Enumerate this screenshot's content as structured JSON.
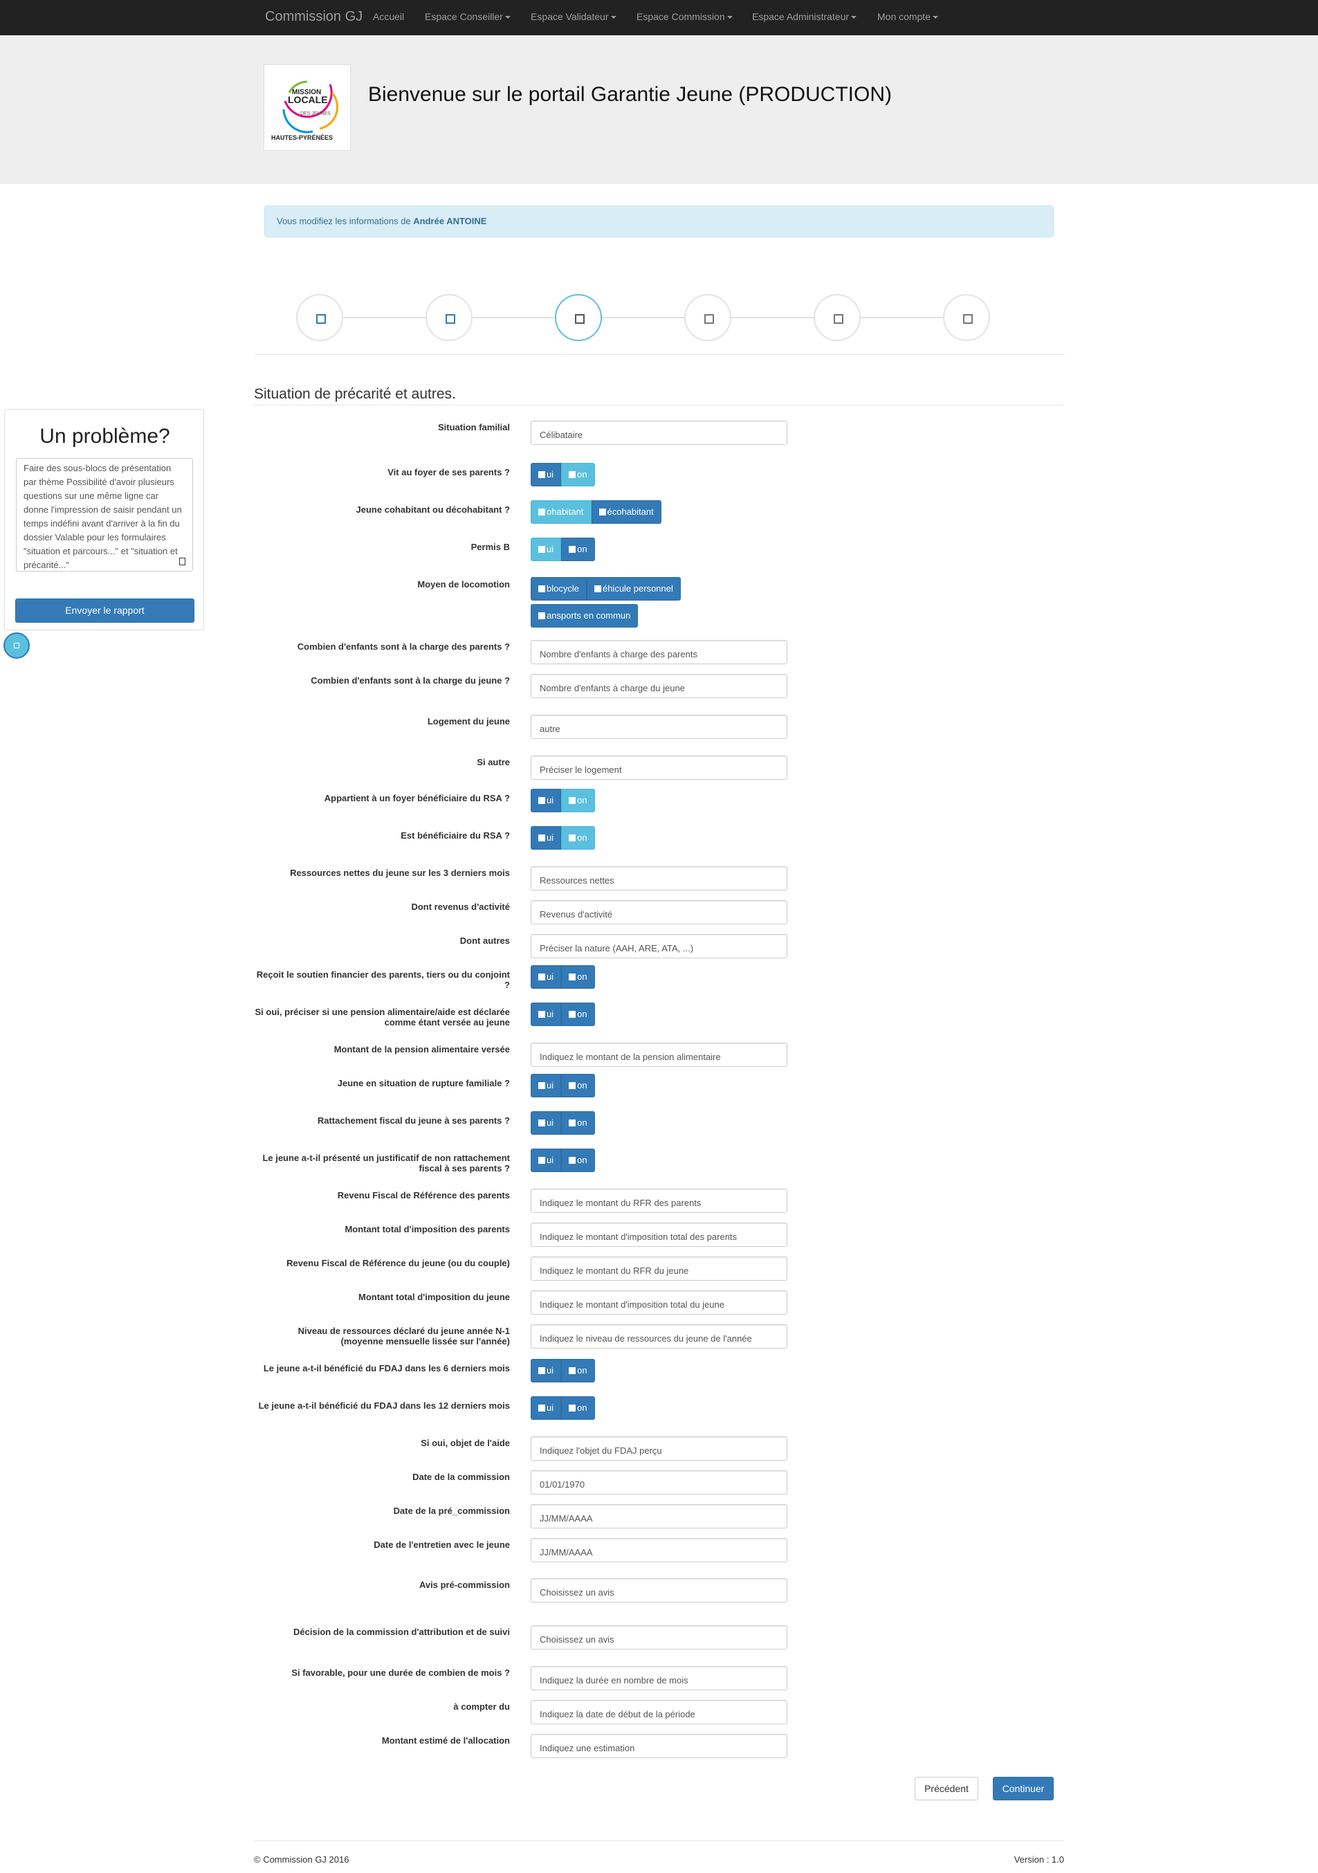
{
  "nav": {
    "brand": "Commission GJ",
    "items": [
      "Accueil",
      "Espace Conseiller",
      "Espace Validateur",
      "Espace Commission",
      "Espace Administrateur",
      "Mon compte"
    ]
  },
  "header": {
    "logo_text": "MISSION LOCALE DES JEUNES HAUTES-PYRÉNÉES",
    "title": "Bienvenue sur le portail Garantie Jeune (PRODUCTION)"
  },
  "alert": {
    "prefix": "Vous modifiez les informations de",
    "name": "Andrée ANTOINE"
  },
  "steps": [
    "done",
    "done",
    "active",
    "todo",
    "todo",
    "todo"
  ],
  "section_title": "Situation de précarité et autres.",
  "fields": [
    {
      "label": "Situation familial",
      "type": "input",
      "value": "Célibataire"
    },
    {
      "label": "Vit au foyer de ses parents ?",
      "type": "toggle",
      "options": [
        "ui",
        "on"
      ],
      "active": 1
    },
    {
      "label": "Jeune cohabitant ou décohabitant ?",
      "type": "toggle",
      "options": [
        "ohabitant",
        "écohabitant"
      ],
      "active": 0
    },
    {
      "label": "Permis B",
      "type": "toggle",
      "options": [
        "ui",
        "on"
      ],
      "active": 0
    },
    {
      "label": "Moyen de locomotion",
      "type": "multi",
      "options": [
        "blocycle",
        "éhicule personnel",
        "ansports en commun"
      ]
    },
    {
      "label": "Combien d'enfants sont à la charge des parents ?",
      "type": "input",
      "value": "Nombre d'enfants à charge des parents"
    },
    {
      "label": "Combien d'enfants sont à la charge du jeune ?",
      "type": "input",
      "value": "Nombre d'enfants à charge du jeune"
    },
    {
      "label": "Logement du jeune",
      "type": "input",
      "value": "autre"
    },
    {
      "label": "Si autre",
      "type": "input",
      "value": "Préciser le logement"
    },
    {
      "label": "Appartient à un foyer bénéficiaire du RSA ?",
      "type": "toggle",
      "options": [
        "ui",
        "on"
      ],
      "active": 1
    },
    {
      "label": "Est bénéficiaire du RSA ?",
      "type": "toggle",
      "options": [
        "ui",
        "on"
      ],
      "active": 1
    },
    {
      "label": "Ressources nettes du jeune sur les 3 derniers mois",
      "type": "input",
      "value": "Ressources nettes"
    },
    {
      "label": "Dont revenus d'activité",
      "type": "input",
      "value": "Revenus d'activité"
    },
    {
      "label": "Dont autres",
      "type": "input",
      "value": "Préciser la nature (AAH, ARE, ATA, ...)"
    },
    {
      "label": "Reçoit le soutien financier des parents, tiers ou du conjoint ?",
      "type": "toggle",
      "options": [
        "ui",
        "on"
      ],
      "active": -1
    },
    {
      "label": "Si oui, préciser si une pension alimentaire/aide est déclarée comme étant versée au jeune",
      "type": "toggle",
      "options": [
        "ui",
        "on"
      ],
      "active": -1
    },
    {
      "label": "Montant de la pension alimentaire versée",
      "type": "input",
      "value": "Indiquez le montant de la pension alimentaire"
    },
    {
      "label": "Jeune en situation de rupture familiale ?",
      "type": "toggle",
      "options": [
        "ui",
        "on"
      ],
      "active": -1
    },
    {
      "label": "Rattachement fiscal du jeune à ses parents ?",
      "type": "toggle",
      "options": [
        "ui",
        "on"
      ],
      "active": -1
    },
    {
      "label": "Le jeune a-t-il présenté un justificatif de non rattachement fiscal à ses parents ?",
      "type": "toggle",
      "options": [
        "ui",
        "on"
      ],
      "active": -1
    },
    {
      "label": "Revenu Fiscal de Référence des parents",
      "type": "input",
      "value": "Indiquez le montant du RFR des parents"
    },
    {
      "label": "Montant total d'imposition des parents",
      "type": "input",
      "value": "Indiquez le montant d'imposition total des parents"
    },
    {
      "label": "Revenu Fiscal de Référence du jeune (ou du couple)",
      "type": "input",
      "value": "Indiquez le montant du RFR du jeune"
    },
    {
      "label": "Montant total d'imposition du jeune",
      "type": "input",
      "value": "Indiquez le montant d'imposition total du jeune"
    },
    {
      "label": "Niveau de ressources déclaré du jeune année N-1 (moyenne mensuelle lissée sur l'année)",
      "type": "input",
      "value": "Indiquez le niveau de ressources du jeune de l'année"
    },
    {
      "label": "Le jeune a-t-il bénéficié du FDAJ dans les 6 derniers mois",
      "type": "toggle",
      "options": [
        "ui",
        "on"
      ],
      "active": -1
    },
    {
      "label": "Le jeune a-t-il bénéficié du FDAJ dans les 12 derniers mois",
      "type": "toggle",
      "options": [
        "ui",
        "on"
      ],
      "active": -1
    },
    {
      "label": "Si oui, objet de l'aide",
      "type": "input",
      "value": "Indiquez l'objet du FDAJ perçu"
    },
    {
      "label": "Date de la commission",
      "type": "input",
      "value": "01/01/1970"
    },
    {
      "label": "Date de la pré_commission",
      "type": "input",
      "value": "JJ/MM/AAAA"
    },
    {
      "label": "Date de l'entretien avec le jeune",
      "type": "input",
      "value": "JJ/MM/AAAA"
    },
    {
      "label": "Avis pré-commission",
      "type": "input",
      "value": "Choisissez un avis"
    },
    {
      "label": "Décision de la commission d'attribution et de suivi",
      "type": "input",
      "value": "Choisissez un avis"
    },
    {
      "label": "Si favorable, pour une durée de combien de mois ?",
      "type": "input",
      "value": "Indiquez la durée en nombre de mois"
    },
    {
      "label": "à compter du",
      "type": "input",
      "value": "Indiquez la date de début de la période"
    },
    {
      "label": "Montant estimé de l'allocation",
      "type": "input",
      "value": "Indiquez une estimation"
    }
  ],
  "sidebar": {
    "title": "Un problème?",
    "text": "Faire des sous-blocs de présentation par thème Possibilité d'avoir plusieurs questions sur une même ligne car donne l'impression de saisir pendant un temps indéfini avant d'arriver à la fin du dossier Valable pour les formulaires \"situation et parcours...\" et \"situation et précarité...\"",
    "button": "Envoyer le rapport"
  },
  "buttons": {
    "prev": "Précédent",
    "next": "Continuer"
  },
  "footer": {
    "left": "© Commission GJ 2016",
    "right": "Version : 1.0"
  },
  "colors": {
    "primary": "#337ab7",
    "info": "#5bc0de",
    "navbar": "#222222",
    "jumbotron": "#eeeeee"
  }
}
